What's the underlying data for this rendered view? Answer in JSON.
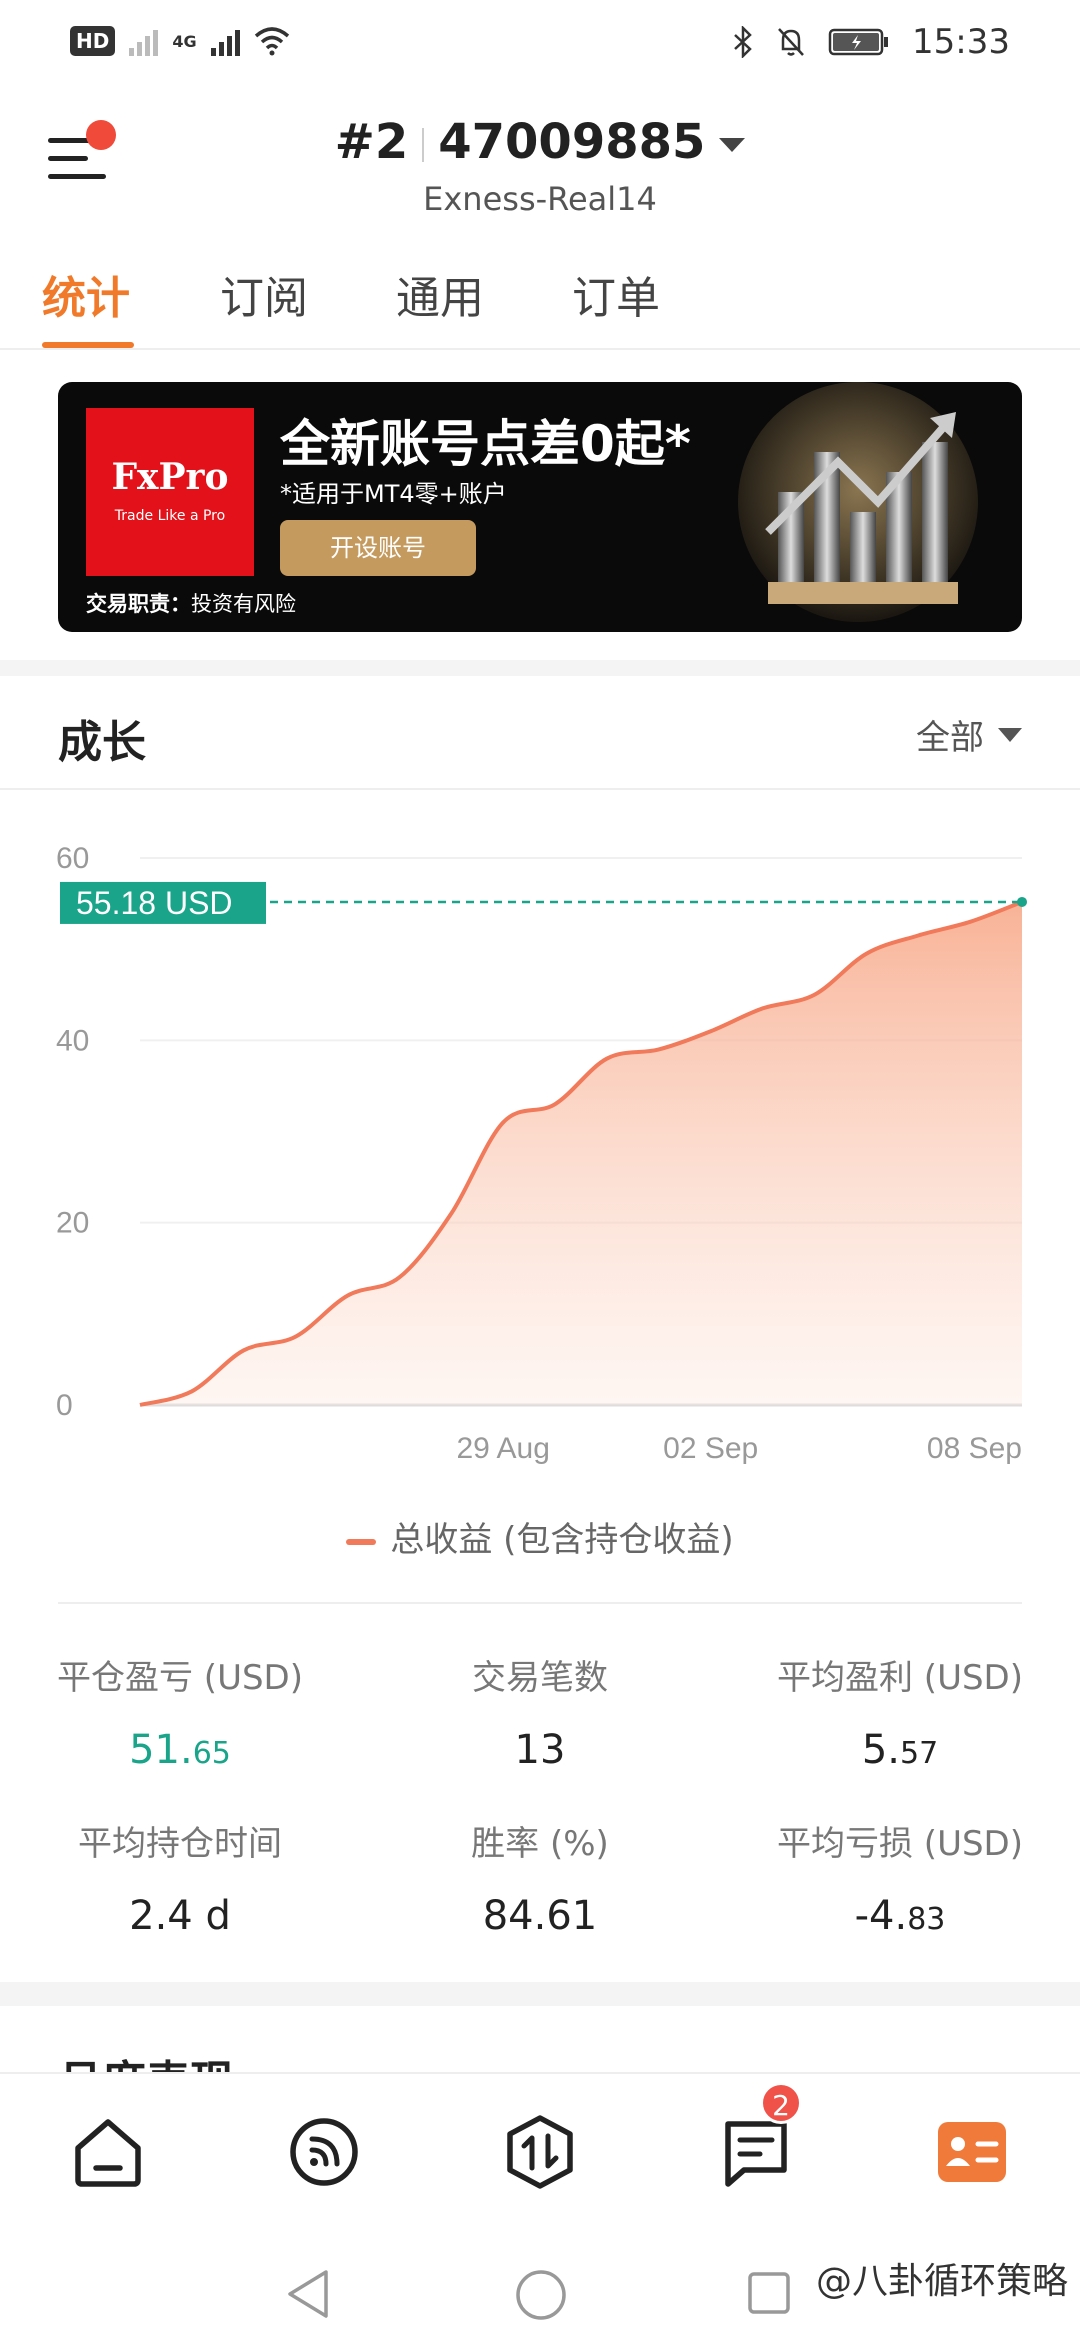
{
  "status_bar": {
    "hd": "HD",
    "network": "4G",
    "time": "15:33"
  },
  "header": {
    "account_index": "#2",
    "account_number": "47009885",
    "server": "Exness-Real14"
  },
  "tabs": [
    {
      "label": "统计",
      "active": true
    },
    {
      "label": "订阅",
      "active": false
    },
    {
      "label": "通用",
      "active": false
    },
    {
      "label": "订单",
      "active": false
    }
  ],
  "banner": {
    "logo": "FxPro",
    "logo_tagline": "Trade Like a Pro",
    "headline": "全新账号点差0起*",
    "subtext": "*适用于MT4零+账户",
    "button_label": "开设账号",
    "footer_bold": "交易职责：",
    "footer_text": "投资有风险"
  },
  "growth": {
    "title": "成长",
    "filter": "全部",
    "current_label": "55.18 USD",
    "legend": "总收益 (包含持仓收益)"
  },
  "chart_data": {
    "type": "area",
    "x": [
      "2024-08-22",
      "2024-08-23",
      "2024-08-24",
      "2024-08-25",
      "2024-08-26",
      "2024-08-27",
      "2024-08-28",
      "2024-08-29",
      "2024-08-30",
      "2024-08-31",
      "2024-09-01",
      "2024-09-02",
      "2024-09-03",
      "2024-09-04",
      "2024-09-05",
      "2024-09-06",
      "2024-09-07",
      "2024-09-08"
    ],
    "series": [
      {
        "name": "总收益 (包含持仓收益)",
        "values": [
          0,
          1.5,
          6,
          7.5,
          12,
          14,
          21,
          31,
          33,
          38,
          39,
          41,
          43.5,
          45,
          49.5,
          51.5,
          53,
          55.18
        ]
      }
    ],
    "x_tick_labels": [
      "29 Aug",
      "02 Sep",
      "08 Sep"
    ],
    "y_ticks": [
      0,
      20,
      40,
      60
    ],
    "ylim": [
      0,
      60
    ],
    "current_value_label": "55.18 USD",
    "line_color": "#f07a5a",
    "marker_color": "#1aa58a",
    "grid": true
  },
  "stats": {
    "closed_pnl": {
      "label": "平仓盈亏 (USD)",
      "int": "51.",
      "dec": "65"
    },
    "trades": {
      "label": "交易笔数",
      "value": "13"
    },
    "avg_profit": {
      "label": "平均盈利 (USD)",
      "int": "5.",
      "dec": "57"
    },
    "avg_hold": {
      "label": "平均持仓时间",
      "value": "2.4 d"
    },
    "win_rate": {
      "label": "胜率 (%)",
      "value": "84.61"
    },
    "avg_loss": {
      "label": "平均亏损 (USD)",
      "int": "-4.",
      "dec": "83"
    }
  },
  "monthly": {
    "title": "月度表现"
  },
  "bottom_nav": {
    "items": [
      "home-icon",
      "feed-icon",
      "trade-icon",
      "messages-icon",
      "profile-card-icon"
    ],
    "messages_badge": "2",
    "active_color": "#f07a3a"
  },
  "watermark": "@八卦循环策略"
}
